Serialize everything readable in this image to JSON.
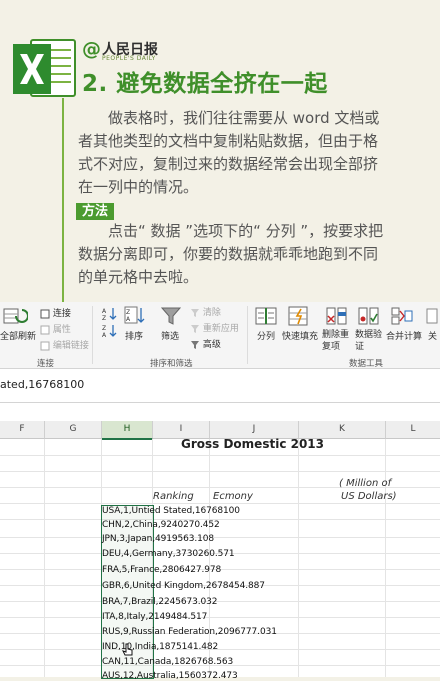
{
  "article": {
    "brand_at": "@",
    "brand_cn": "人民日报",
    "brand_en": "PEOPLE'S DAILY",
    "heading": "2. 避免数据全挤在一起",
    "para1": "　　做表格时，我们往往需要从 word 文档或者其他类型的文档中复制粘贴数据，但由于格式不对应，复制过来的数据经常会出现全部挤在一列中的情况。",
    "tag": "方法",
    "para2": "　　点击“ 数据 ”选项下的“ 分列 ”，按要求把数据分离即可，你要的数据就乖乖地跑到不同的单元格中去啦。"
  },
  "ribbon": {
    "refresh_all": "全部刷新",
    "connections": "连接",
    "properties": "属性",
    "edit_links": "编辑链接",
    "group_connections": "连接",
    "sort": "排序",
    "filter": "筛选",
    "clear": "清除",
    "reapply": "重新应用",
    "advanced": "高级",
    "group_sort_filter": "排序和筛选",
    "text_to_columns": "分列",
    "flash_fill": "快速填充",
    "remove_duplicates": "删除重复项",
    "data_validation": "数据验证",
    "consolidate": "合并计算",
    "relationships": "关",
    "group_data_tools": "数据工具"
  },
  "formula_bar": {
    "content": "ated,16768100"
  },
  "grid": {
    "columns": [
      "F",
      "G",
      "H",
      "I",
      "J",
      "K",
      "L"
    ],
    "selected_column": "H",
    "title": "Gross Domestic 2013",
    "header_ranking": "Ranking",
    "header_economy": "Ecmony",
    "unit_line1": "( Million of",
    "unit_line2": "US Dollars)",
    "rows": [
      "USA,1,Untied Stated,16768100",
      "CHN,2,China,9240270.452",
      "JPN,3,Japan,4919563.108",
      "DEU,4,Germany,3730260.571",
      "FRA,5,France,2806427.978",
      "GBR,6,United Kingdom,2678454.887",
      "BRA,7,Brazil,2245673.032",
      "ITA,8,Italy,2149484.517",
      "RUS,9,Russian Federation,2096777.031",
      "IND,10,India,1875141.482",
      "CAN,11,Canada,1826768.563",
      "AUS,12,Australia,1560372.473"
    ]
  },
  "colors": {
    "excel_green": "#217346",
    "accent_green": "#4b9b2f",
    "page_bg": "#f3f1e6"
  }
}
